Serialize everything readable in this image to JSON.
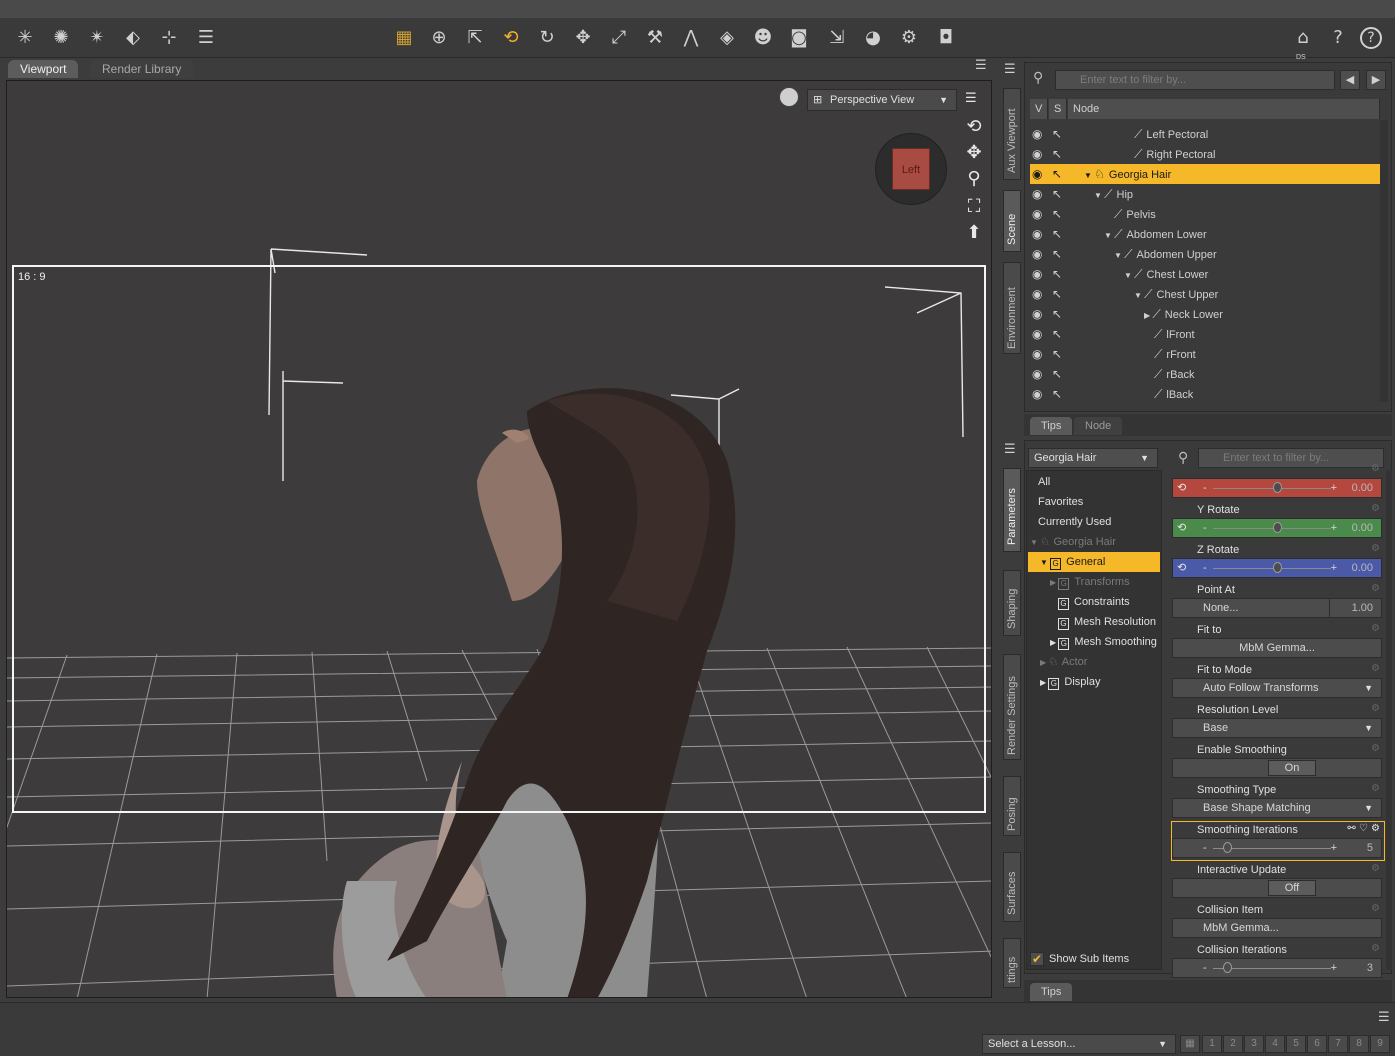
{
  "toolbar": {
    "icons": [
      "spotlight-icon",
      "distant-light-icon",
      "point-light-icon",
      "create-primitive-icon",
      "node-weight-icon",
      "align-icon",
      "grid-icon",
      "universal-tool-icon",
      "node-selection-icon",
      "rotate-tool-icon",
      "twist-tool-icon",
      "translate-tool-icon",
      "scale-tool-icon",
      "joint-editor-icon",
      "morph-tool-icon",
      "geometry-editor-icon",
      "figure-shaping-icon",
      "camera-icon",
      "region-navigator-icon",
      "surface-selection-icon",
      "render-settings-icon",
      "render-icon"
    ],
    "right_icons": [
      "daz-home-icon",
      "whats-this-icon",
      "help-icon"
    ],
    "ds_label": "DS"
  },
  "viewport_tabs": [
    {
      "label": "Viewport"
    },
    {
      "label": "Render Library"
    }
  ],
  "viewport": {
    "aspect_label": "16 : 9",
    "view_select": "Perspective View",
    "view_cube_face": "Left"
  },
  "side_tabs_top": [
    "Aux Viewport",
    "Scene",
    "Environment"
  ],
  "side_tabs_bottom": [
    "Parameters",
    "Shaping",
    "Render Settings",
    "Posing",
    "Surfaces",
    "ttings"
  ],
  "scene": {
    "filter_placeholder": "Enter text to filter by...",
    "columns": {
      "v": "V",
      "s": "S",
      "node": "Node"
    },
    "rows": [
      {
        "label": "Left Pectoral",
        "indent": 6,
        "expander": "",
        "icon": "bone"
      },
      {
        "label": "Right Pectoral",
        "indent": 6,
        "expander": "",
        "icon": "bone"
      },
      {
        "label": "Georgia Hair",
        "indent": 1,
        "expander": "▼",
        "icon": "figure",
        "selected": true
      },
      {
        "label": "Hip",
        "indent": 2,
        "expander": "▼",
        "icon": "bone"
      },
      {
        "label": "Pelvis",
        "indent": 4,
        "expander": "",
        "icon": "bone"
      },
      {
        "label": "Abdomen Lower",
        "indent": 3,
        "expander": "▼",
        "icon": "bone"
      },
      {
        "label": "Abdomen Upper",
        "indent": 4,
        "expander": "▼",
        "icon": "bone"
      },
      {
        "label": "Chest Lower",
        "indent": 5,
        "expander": "▼",
        "icon": "bone"
      },
      {
        "label": "Chest Upper",
        "indent": 6,
        "expander": "▼",
        "icon": "bone"
      },
      {
        "label": "Neck Lower",
        "indent": 7,
        "expander": "▶",
        "icon": "bone"
      },
      {
        "label": "lFront",
        "indent": 8,
        "expander": "",
        "icon": "bone"
      },
      {
        "label": "rFront",
        "indent": 8,
        "expander": "",
        "icon": "bone"
      },
      {
        "label": "rBack",
        "indent": 8,
        "expander": "",
        "icon": "bone"
      },
      {
        "label": "lBack",
        "indent": 8,
        "expander": "",
        "icon": "bone"
      }
    ],
    "bottom_tabs": [
      "Tips",
      "Node"
    ]
  },
  "parameters": {
    "node_select": "Georgia Hair",
    "filter_placeholder": "Enter text to filter by...",
    "categories": [
      {
        "label": "All",
        "indent": 0,
        "expander": "",
        "icon": "",
        "state": ""
      },
      {
        "label": "Favorites",
        "indent": 0,
        "expander": "",
        "icon": "",
        "state": ""
      },
      {
        "label": "Currently Used",
        "indent": 0,
        "expander": "",
        "icon": "",
        "state": ""
      },
      {
        "label": "Georgia Hair",
        "indent": 0,
        "expander": "▼",
        "icon": "figure",
        "state": "dim"
      },
      {
        "label": "General",
        "indent": 1,
        "expander": "▼",
        "icon": "G",
        "state": "sel"
      },
      {
        "label": "Transforms",
        "indent": 2,
        "expander": "▶",
        "icon": "G",
        "state": "dim"
      },
      {
        "label": "Constraints",
        "indent": 2,
        "expander": "",
        "icon": "G",
        "state": ""
      },
      {
        "label": "Mesh Resolution",
        "indent": 2,
        "expander": "",
        "icon": "G",
        "state": ""
      },
      {
        "label": "Mesh Smoothing",
        "indent": 2,
        "expander": "▶",
        "icon": "G",
        "state": ""
      },
      {
        "label": "Actor",
        "indent": 1,
        "expander": "▶",
        "icon": "figure",
        "state": "dim"
      },
      {
        "label": "Display",
        "indent": 1,
        "expander": "▶",
        "icon": "G",
        "state": ""
      }
    ],
    "show_sub_items": "Show Sub Items",
    "show_sub_items_checked": true,
    "params": [
      {
        "name": "",
        "kind": "slider",
        "value": "0.00",
        "accent": "#b4473e",
        "fraction": 0.5
      },
      {
        "name": "Y Rotate",
        "kind": "slider",
        "value": "0.00",
        "accent": "#4a8a4a",
        "fraction": 0.5
      },
      {
        "name": "Z Rotate",
        "kind": "slider",
        "value": "0.00",
        "accent": "#4a5aa8",
        "fraction": 0.5
      },
      {
        "name": "Point At",
        "kind": "node",
        "value": "None...",
        "extra": "1.00"
      },
      {
        "name": "Fit to",
        "kind": "button",
        "value": "MbM Gemma..."
      },
      {
        "name": "Fit to Mode",
        "kind": "select",
        "value": "Auto Follow Transforms"
      },
      {
        "name": "Resolution Level",
        "kind": "select",
        "value": "Base"
      },
      {
        "name": "Enable Smoothing",
        "kind": "toggle",
        "value": "On"
      },
      {
        "name": "Smoothing Type",
        "kind": "select",
        "value": "Base Shape Matching"
      },
      {
        "name": "Smoothing Iterations",
        "kind": "slider",
        "value": "5",
        "fraction": 0.08,
        "highlight": true
      },
      {
        "name": "Interactive Update",
        "kind": "toggle",
        "value": "Off"
      },
      {
        "name": "Collision Item",
        "kind": "node",
        "value": "MbM Gemma..."
      },
      {
        "name": "Collision Iterations",
        "kind": "slider",
        "value": "3",
        "fraction": 0.08
      }
    ],
    "bottom_tab": "Tips"
  },
  "statusbar": {
    "lesson_select": "Select a Lesson...",
    "lesson_steps": [
      "1",
      "2",
      "3",
      "4",
      "5",
      "6",
      "7",
      "8",
      "9"
    ]
  },
  "colors": {
    "selection": "#f5b829",
    "panel": "#3a3a3a"
  }
}
